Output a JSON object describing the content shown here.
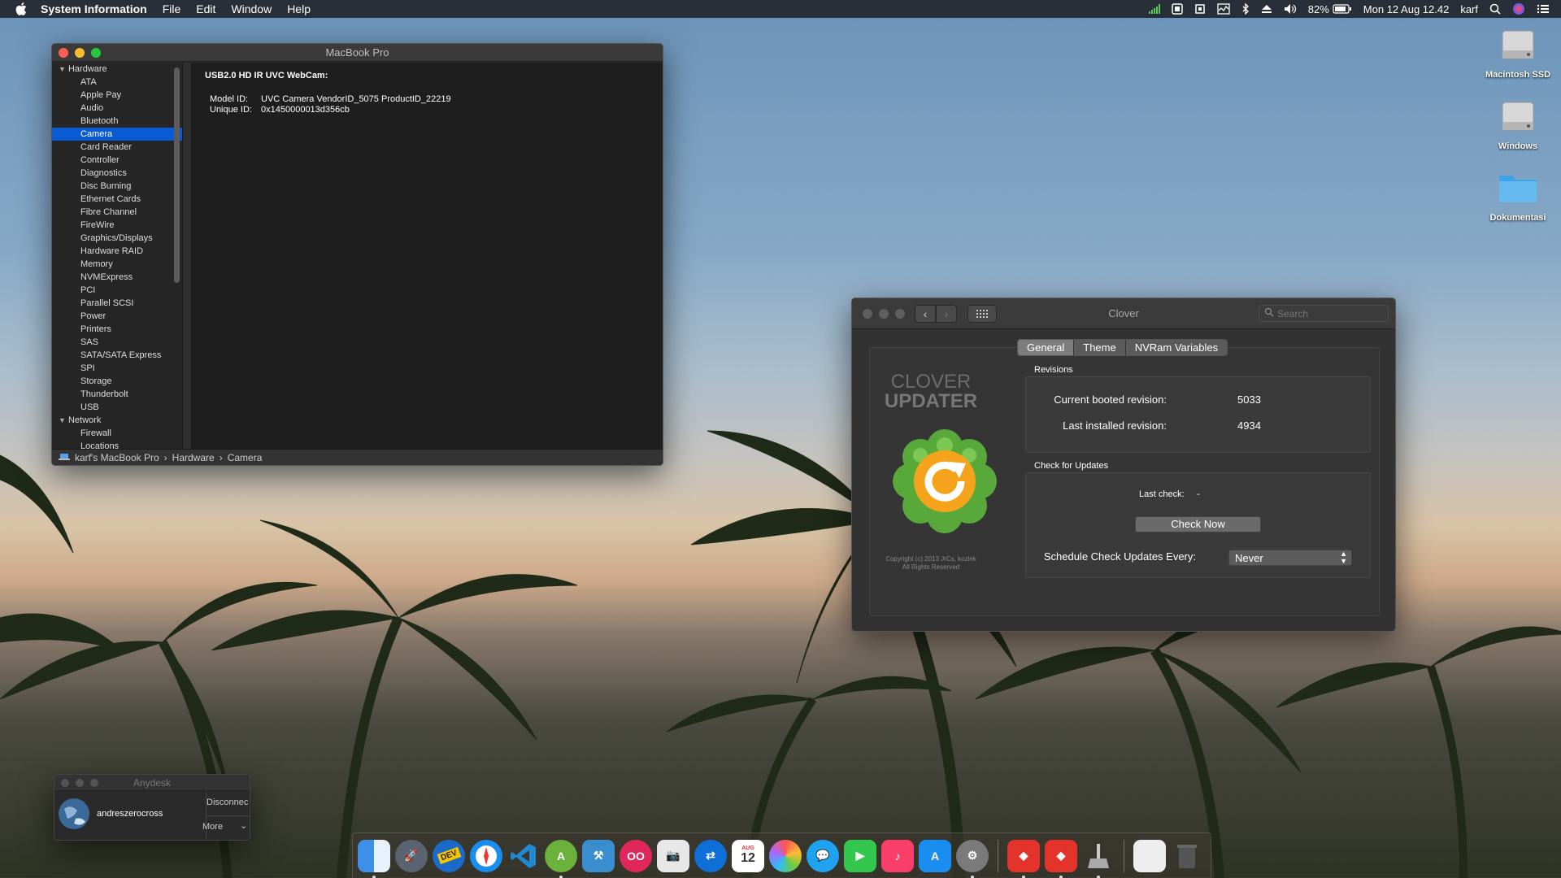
{
  "menubar": {
    "app_name": "System Information",
    "items": [
      "File",
      "Edit",
      "Window",
      "Help"
    ],
    "battery": "82%",
    "clock": "Mon 12 Aug 12.42",
    "user": "karf"
  },
  "desktop_icons": [
    "Macintosh SSD",
    "Windows",
    "Dokumentasi"
  ],
  "sysinfo": {
    "title": "MacBook Pro",
    "sidebar": {
      "hardware_label": "Hardware",
      "hardware_items": [
        "ATA",
        "Apple Pay",
        "Audio",
        "Bluetooth",
        "Camera",
        "Card Reader",
        "Controller",
        "Diagnostics",
        "Disc Burning",
        "Ethernet Cards",
        "Fibre Channel",
        "FireWire",
        "Graphics/Displays",
        "Hardware RAID",
        "Memory",
        "NVMExpress",
        "PCI",
        "Parallel SCSI",
        "Power",
        "Printers",
        "SAS",
        "SATA/SATA Express",
        "SPI",
        "Storage",
        "Thunderbolt",
        "USB"
      ],
      "selected": "Camera",
      "network_label": "Network",
      "network_items": [
        "Firewall",
        "Locations"
      ]
    },
    "detail": {
      "heading": "USB2.0 HD IR UVC WebCam:",
      "model_id_label": "Model ID:",
      "model_id": "UVC Camera VendorID_5075 ProductID_22219",
      "unique_id_label": "Unique ID:",
      "unique_id": "0x1450000013d356cb"
    },
    "path": [
      "karf's MacBook Pro",
      "Hardware",
      "Camera"
    ]
  },
  "clover": {
    "title": "Clover",
    "search_placeholder": "Search",
    "tabs": [
      "General",
      "Theme",
      "NVRam Variables"
    ],
    "active_tab": "General",
    "logo_line1": "CLOVER",
    "logo_line2": "UPDATER",
    "copyright_line1": "Copyright (c) 2013 JrCs, kozlek",
    "copyright_line2": "All Rights Reserved",
    "revisions_label": "Revisions",
    "current_booted_label": "Current booted revision:",
    "current_booted_value": "5033",
    "last_installed_label": "Last installed revision:",
    "last_installed_value": "4934",
    "check_updates_label": "Check for Updates",
    "last_check_label": "Last check:",
    "last_check_value": "-",
    "check_now_label": "Check Now",
    "schedule_label": "Schedule Check Updates Every:",
    "schedule_value": "Never"
  },
  "anydesk": {
    "title": "Anydesk",
    "user": "andreszerocross",
    "disconnect": "Disconnec",
    "more": "More"
  },
  "dock": {
    "calendar_month": "AUG",
    "calendar_day": "12",
    "dev_badge": "DEV"
  }
}
